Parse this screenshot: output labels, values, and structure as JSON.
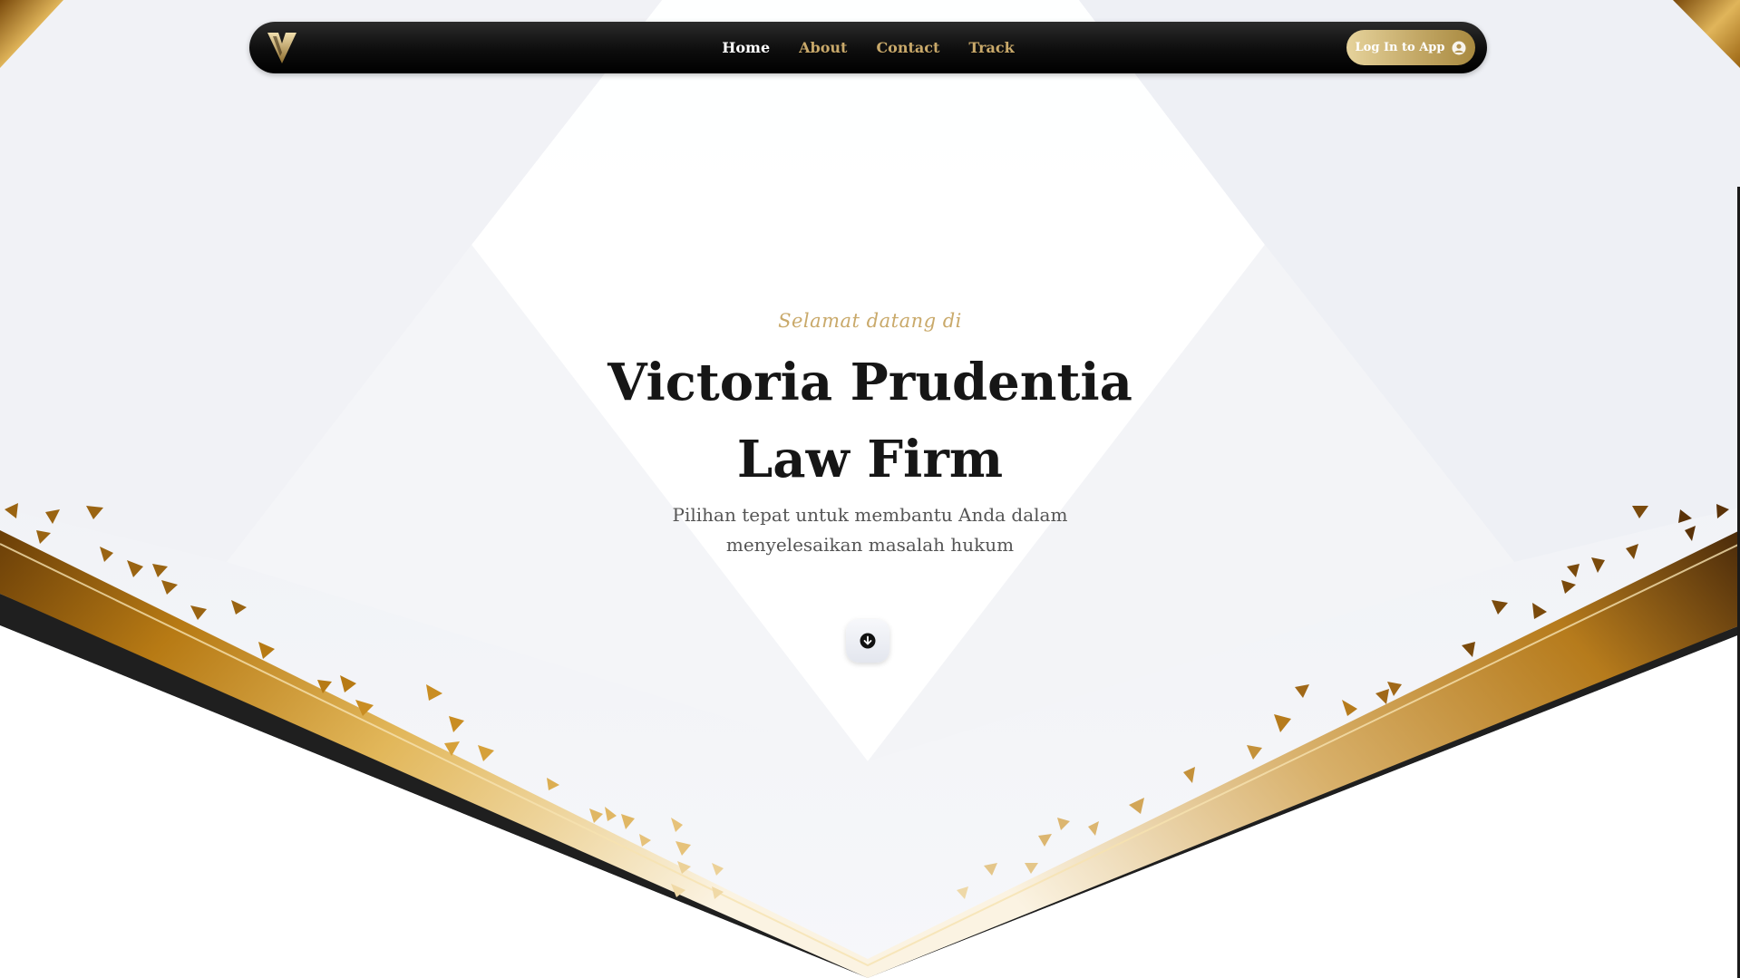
{
  "nav": {
    "logo_alt": "V",
    "links": [
      {
        "label": "Home",
        "active": true
      },
      {
        "label": "About",
        "active": false
      },
      {
        "label": "Contact",
        "active": false
      },
      {
        "label": "Track",
        "active": false
      }
    ],
    "login_label": "Log In to App",
    "login_icon": "user-circle-icon"
  },
  "hero": {
    "kicker": "Selamat datang di",
    "title_line1": "Victoria Prudentia",
    "title_line2": "Law Firm",
    "subtitle": "Pilihan tepat untuk membantu Anda dalam menyelesaikan masalah hukum",
    "scroll_icon": "arrow-down-circle-icon"
  },
  "colors": {
    "gold": "#c9a96a",
    "gold_dark": "#8a5a10",
    "navbar": "#0d0d0d",
    "title": "#161616",
    "subtitle": "#555555"
  }
}
